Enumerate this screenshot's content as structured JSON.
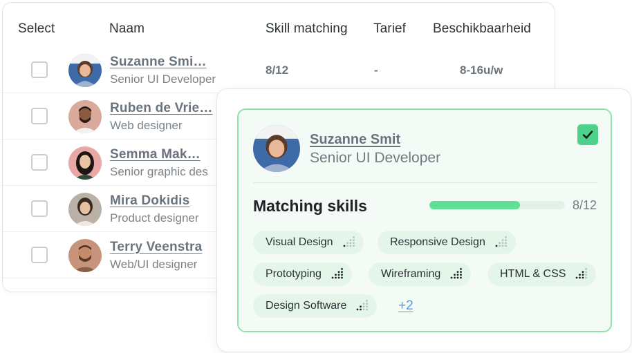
{
  "table": {
    "headers": {
      "select": "Select",
      "naam": "Naam",
      "skill": "Skill matching",
      "tarief": "Tarief",
      "beschikbaarheid": "Beschikbaarheid"
    },
    "rows": [
      {
        "name": "Suzanne Smi…",
        "role": "Senior UI Developer",
        "skill": "8/12",
        "tarief": "-",
        "beschikbaarheid": "8-16u/w",
        "checked": false,
        "avatar": "avatar-woman-smiling"
      },
      {
        "name": "Ruben de Vrie…",
        "role": "Web designer",
        "checked": false,
        "avatar": "avatar-man-beard"
      },
      {
        "name": "Semma Mak…",
        "role": "Senior graphic des",
        "checked": false,
        "avatar": "avatar-woman-dark-hair"
      },
      {
        "name": "Mira Dokidis",
        "role": "Product designer",
        "checked": false,
        "avatar": "avatar-woman-bun"
      },
      {
        "name": "Terry Veenstra",
        "role": "Web/UI designer",
        "checked": false,
        "avatar": "avatar-man-beard-short"
      }
    ]
  },
  "profile": {
    "name": "Suzanne Smit",
    "role": "Senior UI Developer",
    "selected": true,
    "matching_title": "Matching skills",
    "match_value": 8,
    "match_total": 12,
    "match_text": "8/12",
    "skills": [
      {
        "label": "Visual Design",
        "level": 1
      },
      {
        "label": "Responsive Design",
        "level": 1
      },
      {
        "label": "Prototyping",
        "level": 4
      },
      {
        "label": "Wireframing",
        "level": 4
      },
      {
        "label": "HTML & CSS",
        "level": 3
      },
      {
        "label": "Design Software",
        "level": 2
      }
    ],
    "more_label": "+2"
  },
  "colors": {
    "accent_green": "#4ed18a",
    "card_border": "#8de3ab",
    "chip_bg": "#e4f6ea",
    "link_blue": "#4a9eea"
  }
}
